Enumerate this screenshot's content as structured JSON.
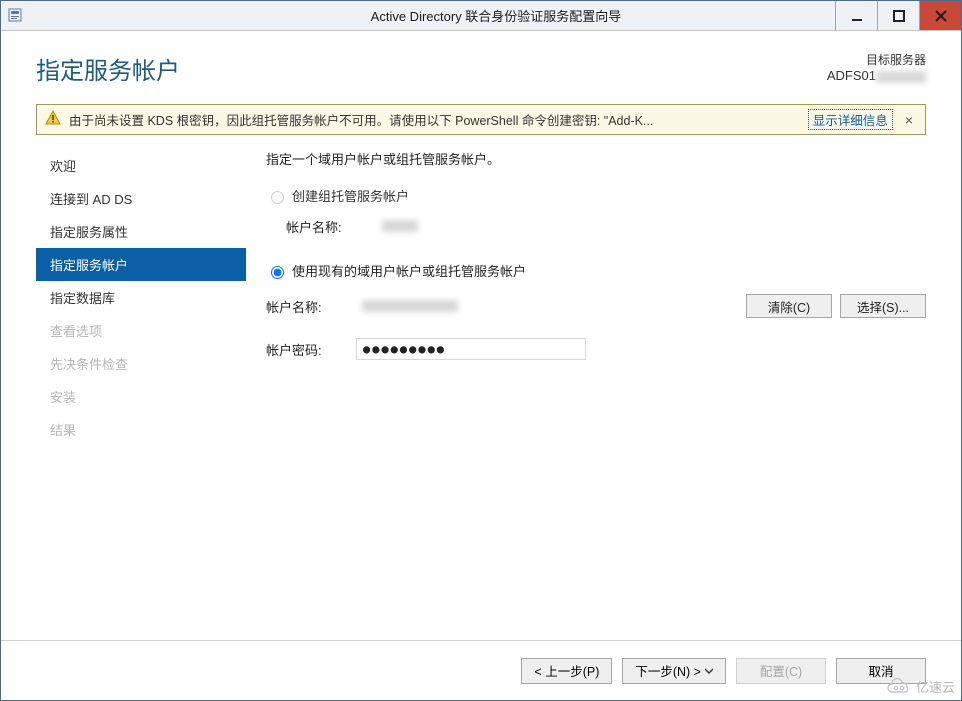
{
  "window": {
    "title": "Active Directory 联合身份验证服务配置向导"
  },
  "header": {
    "page_title": "指定服务帐户",
    "target_label": "目标服务器",
    "target_value": "ADFS01"
  },
  "warning": {
    "text": "由于尚未设置 KDS 根密钥，因此组托管服务帐户不可用。请使用以下 PowerShell 命令创建密钥: \"Add-K...",
    "show_detail": "显示详细信息",
    "close_glyph": "×"
  },
  "nav": {
    "items": [
      {
        "label": "欢迎",
        "state": "normal"
      },
      {
        "label": "连接到 AD DS",
        "state": "normal"
      },
      {
        "label": "指定服务属性",
        "state": "normal"
      },
      {
        "label": "指定服务帐户",
        "state": "selected"
      },
      {
        "label": "指定数据库",
        "state": "normal"
      },
      {
        "label": "查看选项",
        "state": "disabled"
      },
      {
        "label": "先决条件检查",
        "state": "disabled"
      },
      {
        "label": "安装",
        "state": "disabled"
      },
      {
        "label": "结果",
        "state": "disabled"
      }
    ]
  },
  "main": {
    "instruction": "指定一个域用户帐户或组托管服务帐户。",
    "option_create": "创建组托管服务帐户",
    "create_name_label": "帐户名称:",
    "option_existing": "使用现有的域用户帐户或组托管服务帐户",
    "existing_name_label": "帐户名称:",
    "existing_pw_label": "帐户密码:",
    "existing_name_value_masked": true,
    "password_masked": "●●●●●●●●●",
    "btn_clear": "清除(C)",
    "btn_select": "选择(S)..."
  },
  "footer": {
    "back": "< 上一步(P)",
    "next": "下一步(N) >",
    "configure": "配置(C)",
    "cancel": "取消"
  },
  "watermark": "亿速云"
}
